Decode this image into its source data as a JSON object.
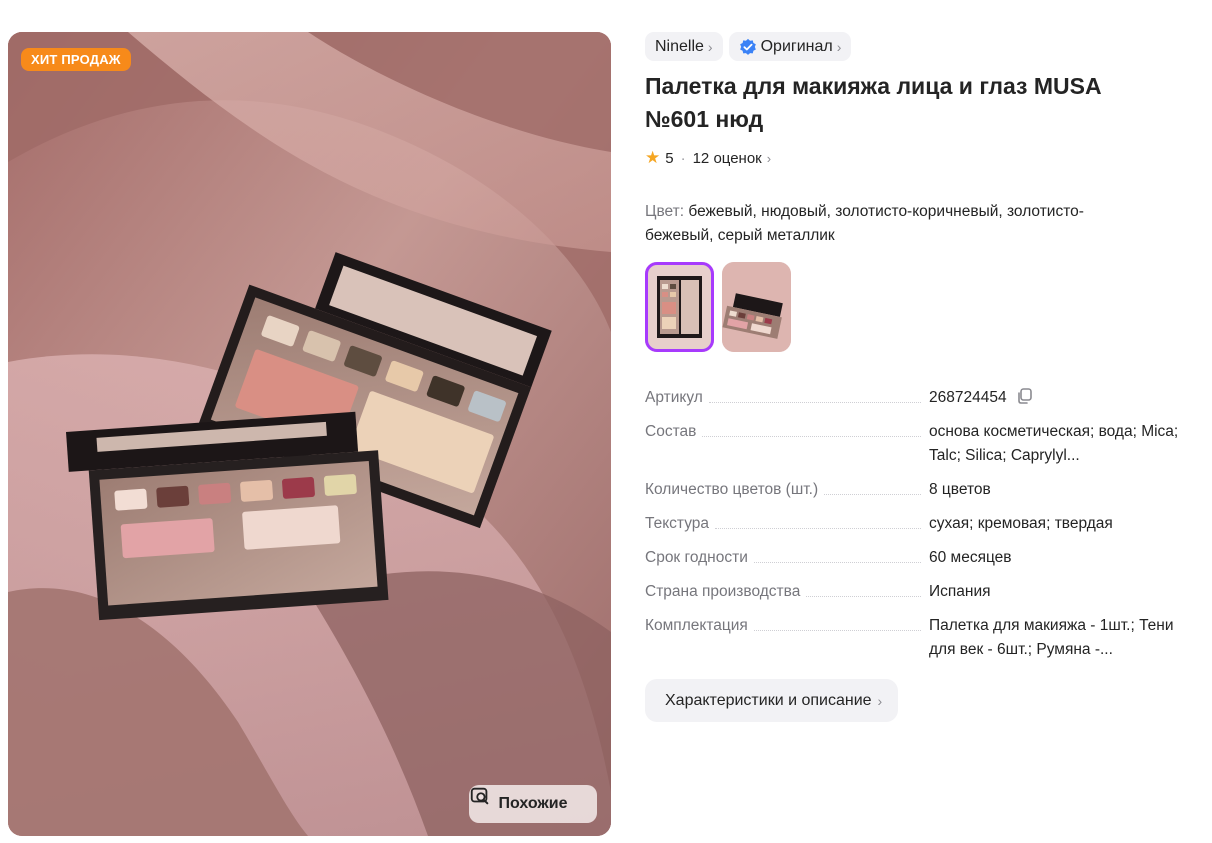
{
  "photo": {
    "badge": "ХИТ ПРОДАЖ",
    "similar_label": "Похожие"
  },
  "chips": {
    "brand": "Ninelle",
    "original": "Оригинал",
    "chevron": "›"
  },
  "product": {
    "title": "Палетка для макияжа лица и глаз MUSA №601 нюд",
    "rating": "5",
    "rating_separator": "·",
    "reviews": "12 оценок",
    "color_label": "Цвет:",
    "color_value": "бежевый, нюдовый, золотисто-коричневый, золотисто-бежевый, серый металлик"
  },
  "specs": [
    {
      "key": "Артикул",
      "value": "268724454"
    },
    {
      "key": "Состав",
      "value": "основа косметическая; вода; Mica; Talc; Silica; Caprylyl..."
    },
    {
      "key": "Количество цветов (шт.)",
      "value": "8 цветов"
    },
    {
      "key": "Текстура",
      "value": "сухая; кремовая; твердая"
    },
    {
      "key": "Срок годности",
      "value": "60 месяцев"
    },
    {
      "key": "Страна производства",
      "value": "Испания"
    },
    {
      "key": "Комплектация",
      "value": "Палетка для макияжа - 1шт.; Тени для век - 6шт.; Румяна -..."
    }
  ],
  "description_button": "Характеристики и описание",
  "colors": {
    "accent": "#a73afd",
    "badge": "#f78a1a",
    "verified": "#3b82f6",
    "star": "#f5a623"
  },
  "icons": {
    "star": "star-icon",
    "verified": "verified-check-icon",
    "copy": "copy-icon",
    "similar": "image-search-icon",
    "chevron": "chevron-right-icon"
  }
}
